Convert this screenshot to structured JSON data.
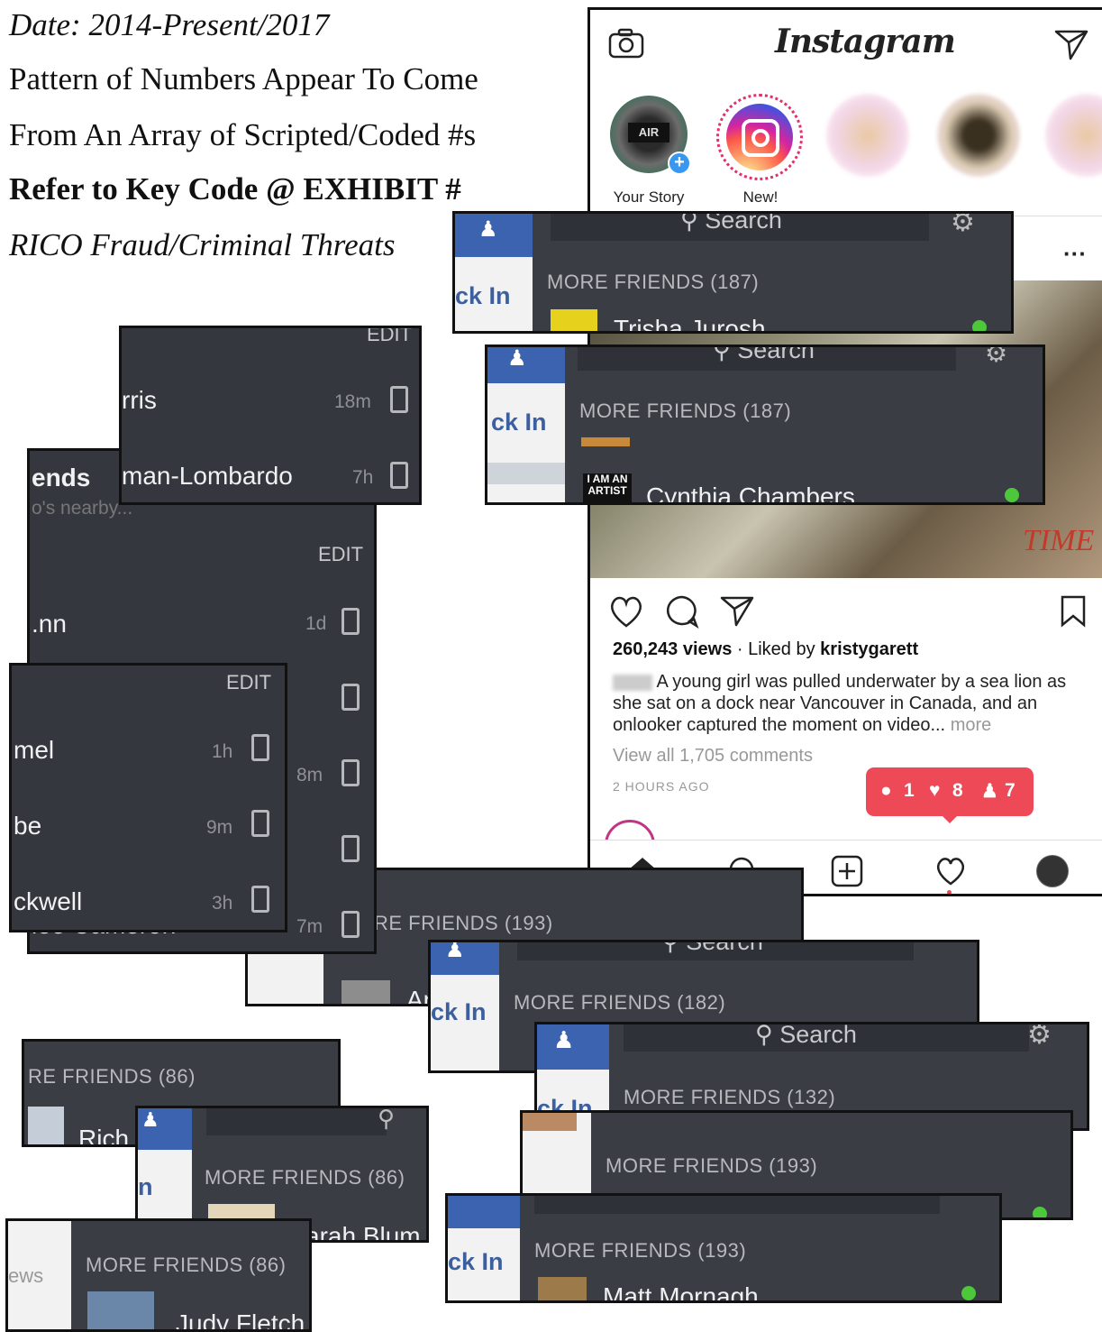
{
  "header": {
    "line1": "Date: 2014-Present/2017",
    "line2": "Pattern of Numbers Appear To Come",
    "line3": "From An Array of Scripted/Coded #s",
    "line4": "Refer to Key Code @ EXHIBIT #",
    "line5": "RICO Fraud/Criminal Threats"
  },
  "instagram": {
    "logo": "Instagram",
    "stories": [
      {
        "label": "Your Story"
      },
      {
        "label": "New!"
      }
    ],
    "views": "260,243 views",
    "liked_prefix": " · Liked by ",
    "liked_by": "kristygarett",
    "caption": "A young girl was pulled underwater by a sea lion as she sat on a dock near Vancouver in Canada, and an onlooker captured the moment on video...",
    "more": "more",
    "comments": "View all 1,705 comments",
    "time_ago": "2 HOURS AGO",
    "photo_mark": "TIME",
    "notifications": {
      "comments": "1",
      "likes": "8",
      "follows": "7"
    },
    "colors": {
      "accent": "#ed4956"
    }
  },
  "fb_panels": [
    {
      "checkin": "ck In",
      "search": "Search",
      "more_friends": "MORE FRIENDS (187)",
      "name": "Trisha Jurosh"
    },
    {
      "checkin": "ck In",
      "search": "Search",
      "more_friends": "MORE FRIENDS (187)",
      "name": "Cynthia Chambers",
      "badge": "I AM AN ARTIST"
    },
    {
      "more_friends": "RE FRIENDS (193)",
      "name": "Ar"
    },
    {
      "checkin": "ck In",
      "search": "Search",
      "more_friends": "MORE FRIENDS (182)"
    },
    {
      "checkin": "ck In",
      "search": "Search",
      "more_friends": "MORE FRIENDS (132)"
    },
    {
      "more_friends": "MORE FRIENDS (193)"
    },
    {
      "checkin": "ck In",
      "more_friends": "MORE FRIENDS (193)",
      "name": "Matt Mornagh"
    },
    {
      "more_friends": "RE FRIENDS (86)",
      "name": "Rich"
    },
    {
      "checkin": "n",
      "more_friends": "MORE FRIENDS (86)",
      "name": "arah Blum"
    },
    {
      "checkin": "ews",
      "more_friends": "MORE FRIENDS (86)",
      "name": "Judy Fletch"
    }
  ],
  "list_a": {
    "edit": "EDIT",
    "rows": [
      {
        "name": "rris",
        "time": "18m"
      },
      {
        "name": "man-Lombardo",
        "time": "7h"
      }
    ]
  },
  "list_b": {
    "title": "ends",
    "sub": "o's nearby...",
    "edit": "EDIT",
    "rows": [
      {
        "name": ".nn",
        "time": "1d"
      },
      {
        "name": "",
        "time": ""
      },
      {
        "name": "",
        "time": "8m"
      },
      {
        "name": "",
        "time": ""
      },
      {
        "name": "lee Cameron",
        "time": "7m"
      }
    ]
  },
  "list_c": {
    "edit": "EDIT",
    "rows": [
      {
        "name": "mel",
        "time": "1h"
      },
      {
        "name": "be",
        "time": "9m"
      },
      {
        "name": "ckwell",
        "time": "3h"
      }
    ]
  }
}
